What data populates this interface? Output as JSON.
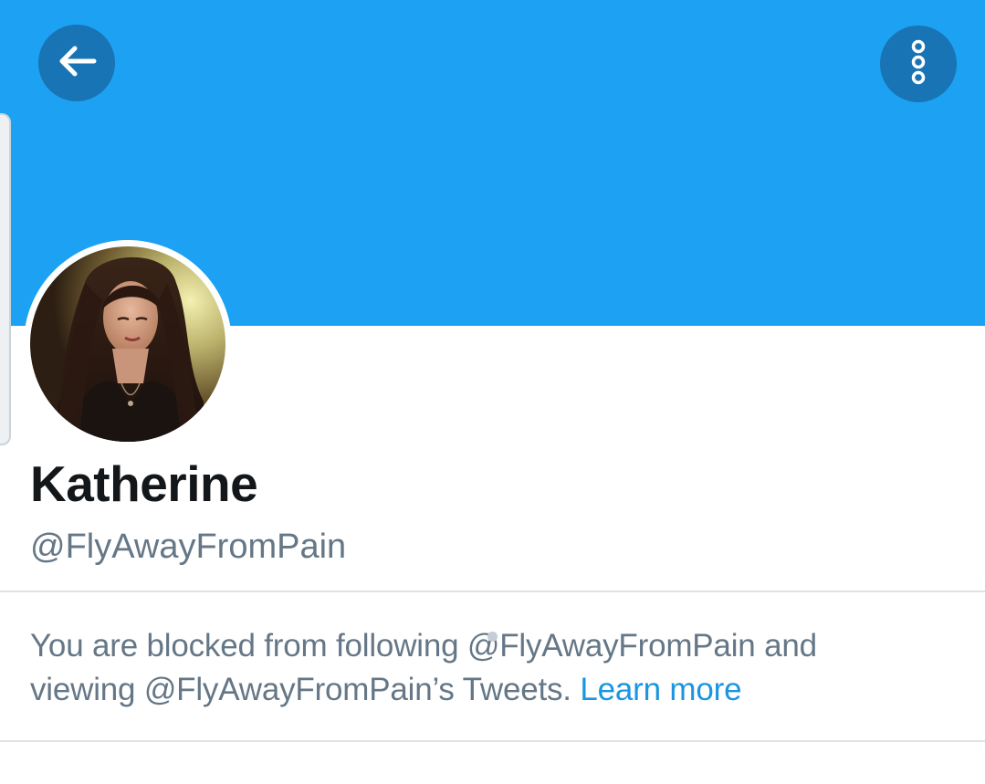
{
  "profile": {
    "display_name": "Katherine",
    "handle": "@FlyAwayFromPain"
  },
  "blocked_notice": {
    "line1": "You are blocked from following @FlyAwayFromPain and",
    "line2": "viewing @FlyAwayFromPain’s Tweets.",
    "learn_more": "Learn more"
  },
  "icons": {
    "back": "arrow-left-icon",
    "more": "vertical-dots-icon"
  },
  "colors": {
    "banner": "#1da1f2",
    "link": "#1b95e0",
    "secondary_text": "#657786",
    "primary_text": "#14171a"
  }
}
